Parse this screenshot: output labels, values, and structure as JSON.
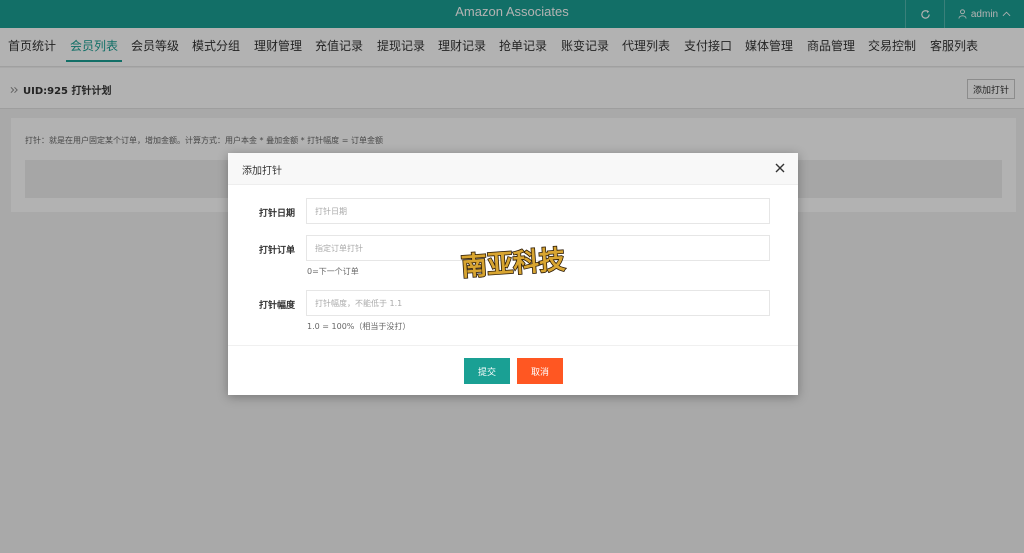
{
  "header": {
    "title": "Amazon Associates",
    "user": "admin"
  },
  "nav": {
    "items": [
      "首页统计",
      "会员列表",
      "会员等级",
      "模式分组",
      "理财管理",
      "充值记录",
      "提现记录",
      "理财记录",
      "抢单记录",
      "账变记录",
      "代理列表",
      "支付接口",
      "媒体管理",
      "商品管理",
      "交易控制",
      "客服列表"
    ],
    "active_index": 1
  },
  "breadcrumb": {
    "text": "UID:925 打针计划"
  },
  "toolbar": {
    "add_label": "添加打针"
  },
  "card": {
    "description": "打针：就是在用户固定某个订单，增加金额。计算方式：用户本金 * 叠加金额 * 打针幅度 = 订单金额"
  },
  "dialog": {
    "title": "添加打针",
    "fields": [
      {
        "label": "打针日期",
        "placeholder": "打针日期",
        "value": "",
        "hint": ""
      },
      {
        "label": "打针订单",
        "placeholder": "指定订单打针",
        "value": "",
        "hint": "0=下一个订单"
      },
      {
        "label": "打针幅度",
        "placeholder": "打针幅度，不能低于 1.1",
        "value": "",
        "hint": "1.0 = 100%（相当于没打）"
      }
    ],
    "submit_label": "提交",
    "cancel_label": "取消"
  },
  "watermark": {
    "text": "南亚科技"
  },
  "colors": {
    "primary": "#1aa094",
    "danger": "#ff5722",
    "overlay": "rgba(0,0,0,0.3)"
  },
  "icons": {
    "refresh": "refresh-icon",
    "user": "user-icon",
    "close": "close-icon",
    "breadcrumb": "double-chevron-right-icon"
  }
}
